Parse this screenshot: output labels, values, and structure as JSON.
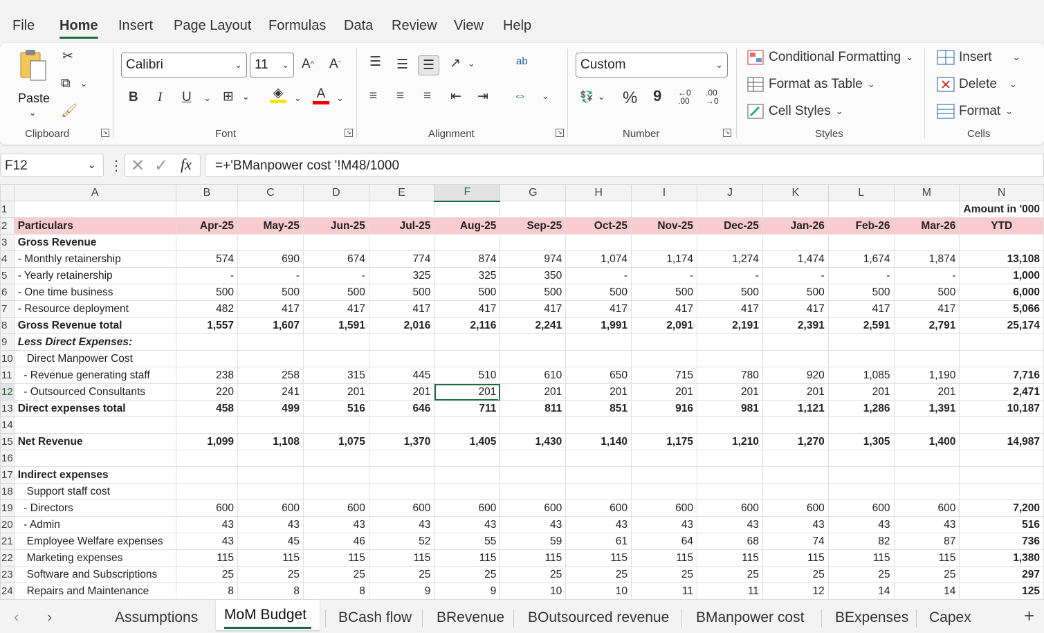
{
  "menu": {
    "tabs": [
      "File",
      "Home",
      "Insert",
      "Page Layout",
      "Formulas",
      "Data",
      "Review",
      "View",
      "Help"
    ],
    "active": "Home"
  },
  "ribbon": {
    "clipboard": {
      "paste": "Paste",
      "label": "Clipboard"
    },
    "font": {
      "name": "Calibri",
      "size": "11",
      "bold": "B",
      "italic": "I",
      "underline": "U",
      "label": "Font",
      "grow": "A^",
      "shrink": "A˅"
    },
    "alignment": {
      "label": "Alignment",
      "wrap": "ab"
    },
    "number": {
      "format": "Custom",
      "label": "Number",
      "percent": "%",
      "comma": "9"
    },
    "styles": {
      "conditional": "Conditional Formatting",
      "table": "Format as Table",
      "cellstyles": "Cell Styles",
      "label": "Styles"
    },
    "cells": {
      "insert": "Insert",
      "delete": "Delete",
      "format": "Format",
      "label": "Cells"
    }
  },
  "formula_bar": {
    "name_box": "F12",
    "formula": "=+'BManpower cost '!M48/1000"
  },
  "columns": [
    "A",
    "B",
    "C",
    "D",
    "E",
    "F",
    "G",
    "H",
    "I",
    "J",
    "K",
    "L",
    "M",
    "N"
  ],
  "rows": [
    {
      "n": "1",
      "a": "",
      "v": [
        "",
        "",
        "",
        "",
        "",
        "",
        "",
        "",
        "",
        "",
        "",
        ""
      ],
      "ytd": "Amount in '000",
      "style": "note"
    },
    {
      "n": "2",
      "a": "Particulars",
      "v": [
        "Apr-25",
        "May-25",
        "Jun-25",
        "Jul-25",
        "Aug-25",
        "Sep-25",
        "Oct-25",
        "Nov-25",
        "Dec-25",
        "Jan-26",
        "Feb-26",
        "Mar-26"
      ],
      "ytd": "YTD",
      "style": "hdr"
    },
    {
      "n": "3",
      "a": "Gross Revenue",
      "v": [
        "",
        "",
        "",
        "",
        "",
        "",
        "",
        "",
        "",
        "",
        "",
        ""
      ],
      "ytd": "",
      "style": "bold"
    },
    {
      "n": "4",
      "a": "- Monthly retainership",
      "v": [
        "574",
        "690",
        "674",
        "774",
        "874",
        "974",
        "1,074",
        "1,174",
        "1,274",
        "1,474",
        "1,674",
        "1,874"
      ],
      "ytd": "13,108",
      "style": ""
    },
    {
      "n": "5",
      "a": "- Yearly retainership",
      "v": [
        "-",
        "-",
        "-",
        "325",
        "325",
        "350",
        "-",
        "-",
        "-",
        "-",
        "-",
        "-"
      ],
      "ytd": "1,000",
      "style": ""
    },
    {
      "n": "6",
      "a": "- One time business",
      "v": [
        "500",
        "500",
        "500",
        "500",
        "500",
        "500",
        "500",
        "500",
        "500",
        "500",
        "500",
        "500"
      ],
      "ytd": "6,000",
      "style": ""
    },
    {
      "n": "7",
      "a": "- Resource deployment",
      "v": [
        "482",
        "417",
        "417",
        "417",
        "417",
        "417",
        "417",
        "417",
        "417",
        "417",
        "417",
        "417"
      ],
      "ytd": "5,066",
      "style": ""
    },
    {
      "n": "8",
      "a": "Gross Revenue total",
      "v": [
        "1,557",
        "1,607",
        "1,591",
        "2,016",
        "2,116",
        "2,241",
        "1,991",
        "2,091",
        "2,191",
        "2,391",
        "2,591",
        "2,791"
      ],
      "ytd": "25,174",
      "style": "bold"
    },
    {
      "n": "9",
      "a": "Less Direct Expenses:",
      "v": [
        "",
        "",
        "",
        "",
        "",
        "",
        "",
        "",
        "",
        "",
        "",
        ""
      ],
      "ytd": "",
      "style": "bolditalic"
    },
    {
      "n": "10",
      "a": "   Direct Manpower Cost",
      "v": [
        "",
        "",
        "",
        "",
        "",
        "",
        "",
        "",
        "",
        "",
        "",
        ""
      ],
      "ytd": "",
      "style": ""
    },
    {
      "n": "11",
      "a": "  - Revenue generating staff",
      "v": [
        "238",
        "258",
        "315",
        "445",
        "510",
        "610",
        "650",
        "715",
        "780",
        "920",
        "1,085",
        "1,190"
      ],
      "ytd": "7,716",
      "style": ""
    },
    {
      "n": "12",
      "a": "  - Outsourced Consultants",
      "v": [
        "220",
        "241",
        "201",
        "201",
        "201",
        "201",
        "201",
        "201",
        "201",
        "201",
        "201",
        "201"
      ],
      "ytd": "2,471",
      "style": ""
    },
    {
      "n": "13",
      "a": "Direct expenses total",
      "v": [
        "458",
        "499",
        "516",
        "646",
        "711",
        "811",
        "851",
        "916",
        "981",
        "1,121",
        "1,286",
        "1,391"
      ],
      "ytd": "10,187",
      "style": "bold"
    },
    {
      "n": "14",
      "a": "",
      "v": [
        "",
        "",
        "",
        "",
        "",
        "",
        "",
        "",
        "",
        "",
        "",
        ""
      ],
      "ytd": "",
      "style": ""
    },
    {
      "n": "15",
      "a": "Net Revenue",
      "v": [
        "1,099",
        "1,108",
        "1,075",
        "1,370",
        "1,405",
        "1,430",
        "1,140",
        "1,175",
        "1,210",
        "1,270",
        "1,305",
        "1,400"
      ],
      "ytd": "14,987",
      "style": "bold"
    },
    {
      "n": "16",
      "a": "",
      "v": [
        "",
        "",
        "",
        "",
        "",
        "",
        "",
        "",
        "",
        "",
        "",
        ""
      ],
      "ytd": "",
      "style": ""
    },
    {
      "n": "17",
      "a": "Indirect expenses",
      "v": [
        "",
        "",
        "",
        "",
        "",
        "",
        "",
        "",
        "",
        "",
        "",
        ""
      ],
      "ytd": "",
      "style": "bold"
    },
    {
      "n": "18",
      "a": "   Support staff cost",
      "v": [
        "",
        "",
        "",
        "",
        "",
        "",
        "",
        "",
        "",
        "",
        "",
        ""
      ],
      "ytd": "",
      "style": ""
    },
    {
      "n": "19",
      "a": "  - Directors",
      "v": [
        "600",
        "600",
        "600",
        "600",
        "600",
        "600",
        "600",
        "600",
        "600",
        "600",
        "600",
        "600"
      ],
      "ytd": "7,200",
      "style": ""
    },
    {
      "n": "20",
      "a": "  - Admin",
      "v": [
        "43",
        "43",
        "43",
        "43",
        "43",
        "43",
        "43",
        "43",
        "43",
        "43",
        "43",
        "43"
      ],
      "ytd": "516",
      "style": ""
    },
    {
      "n": "21",
      "a": "   Employee Welfare expenses",
      "v": [
        "43",
        "45",
        "46",
        "52",
        "55",
        "59",
        "61",
        "64",
        "68",
        "74",
        "82",
        "87"
      ],
      "ytd": "736",
      "style": ""
    },
    {
      "n": "22",
      "a": "   Marketing expenses",
      "v": [
        "115",
        "115",
        "115",
        "115",
        "115",
        "115",
        "115",
        "115",
        "115",
        "115",
        "115",
        "115"
      ],
      "ytd": "1,380",
      "style": ""
    },
    {
      "n": "23",
      "a": "   Software and Subscriptions",
      "v": [
        "25",
        "25",
        "25",
        "25",
        "25",
        "25",
        "25",
        "25",
        "25",
        "25",
        "25",
        "25"
      ],
      "ytd": "297",
      "style": ""
    },
    {
      "n": "24",
      "a": "   Repairs and Maintenance",
      "v": [
        "8",
        "8",
        "8",
        "9",
        "9",
        "10",
        "10",
        "11",
        "11",
        "12",
        "14",
        "14"
      ],
      "ytd": "125",
      "style": ""
    }
  ],
  "selected": {
    "row": "12",
    "col": "F"
  },
  "sheets": [
    "Assumptions",
    "MoM Budget",
    "BCash flow",
    "BRevenue",
    "BOutsourced revenue",
    "BManpower cost",
    "BExpenses",
    "Capex"
  ],
  "active_sheet": "MoM Budget",
  "colors": {
    "header_fill": "#f8cbcf",
    "accent": "#1e6b3f"
  }
}
